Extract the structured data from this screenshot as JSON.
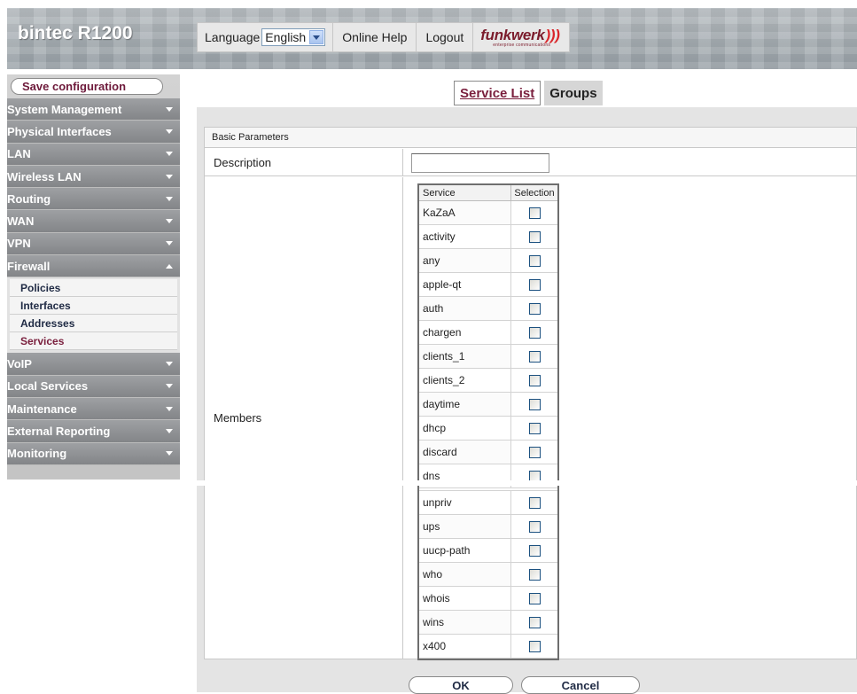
{
  "header": {
    "brand": "bintec R1200",
    "language_label": "Language",
    "language_value": "English",
    "help_label": "Online Help",
    "logout_label": "Logout",
    "logo_text": "funkwerk",
    "logo_subtext": "enterprise communications",
    "logo_accent": "#d9262b"
  },
  "sidebar": {
    "save_label": "Save configuration",
    "items": [
      {
        "label": "System Management",
        "arrow": "down"
      },
      {
        "label": "Physical Interfaces",
        "arrow": "down"
      },
      {
        "label": "LAN",
        "arrow": "down"
      },
      {
        "label": "Wireless LAN",
        "arrow": "down"
      },
      {
        "label": "Routing",
        "arrow": "down"
      },
      {
        "label": "WAN",
        "arrow": "down"
      },
      {
        "label": "VPN",
        "arrow": "down"
      },
      {
        "label": "Firewall",
        "arrow": "up"
      },
      {
        "label": "VoIP",
        "arrow": "down"
      },
      {
        "label": "Local Services",
        "arrow": "down"
      },
      {
        "label": "Maintenance",
        "arrow": "down"
      },
      {
        "label": "External Reporting",
        "arrow": "down"
      },
      {
        "label": "Monitoring",
        "arrow": "down"
      }
    ],
    "firewall_sub": [
      "Policies",
      "Interfaces",
      "Addresses",
      "Services"
    ],
    "active_sub": "Services"
  },
  "tabs": [
    {
      "label": "Service List",
      "active": true
    },
    {
      "label": "Groups",
      "active": false
    }
  ],
  "form": {
    "section_title": "Basic Parameters",
    "description_label": "Description",
    "description_value": "",
    "members_label": "Members",
    "table_headers": {
      "service": "Service",
      "selection": "Selection"
    },
    "services_top": [
      "KaZaA",
      "activity",
      "any",
      "apple-qt",
      "auth",
      "chargen",
      "clients_1",
      "clients_2",
      "daytime",
      "dhcp",
      "discard",
      "dns"
    ],
    "services_bottom": [
      "unpriv",
      "ups",
      "uucp-path",
      "who",
      "whois",
      "wins",
      "x400"
    ]
  },
  "footer": {
    "ok_label": "OK",
    "cancel_label": "Cancel"
  }
}
